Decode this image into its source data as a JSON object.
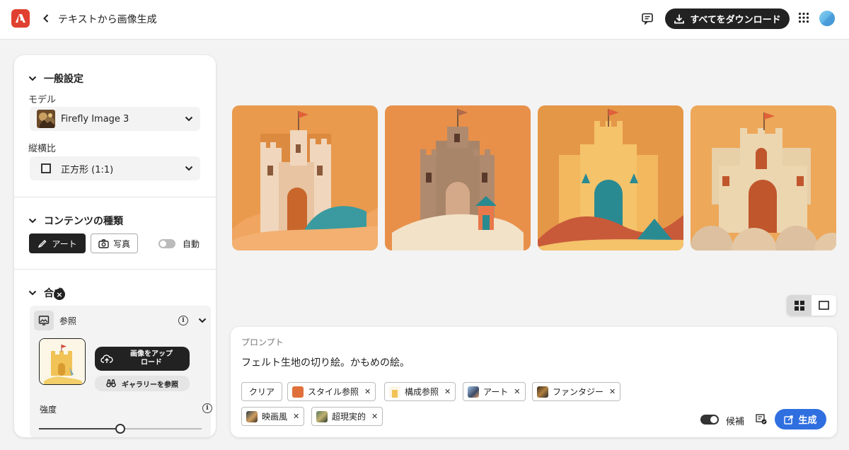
{
  "header": {
    "title": "テキストから画像生成",
    "download_label": "すべてをダウンロード"
  },
  "settings": {
    "general_title": "一般設定",
    "model_label": "モデル",
    "model_value": "Firefly Image 3",
    "aspect_label": "縦横比",
    "aspect_value": "正方形 (1:1)",
    "content_title": "コンテンツの種類",
    "art_label": "アート",
    "photo_label": "写真",
    "auto_label": "自動",
    "composition_title": "合成",
    "reference_label": "参照",
    "upload_label_1": "画像をアップ",
    "upload_label_2": "ロード",
    "gallery_label": "ギャラリーを参照",
    "strength_label": "強度",
    "strength_value": 0.5
  },
  "prompt": {
    "label": "プロンプト",
    "text": "フェルト生地の切り絵。かもめの絵。",
    "clear_label": "クリア",
    "chips": [
      {
        "label": "スタイル参照"
      },
      {
        "label": "構成参照"
      },
      {
        "label": "アート"
      },
      {
        "label": "ファンタジー"
      },
      {
        "label": "映画風"
      },
      {
        "label": "超現実的"
      }
    ],
    "candidate_label": "候補",
    "generate_label": "生成"
  },
  "colors": {
    "accent": "#2f6fe0",
    "dark": "#222222",
    "logo": "#e0402f"
  }
}
